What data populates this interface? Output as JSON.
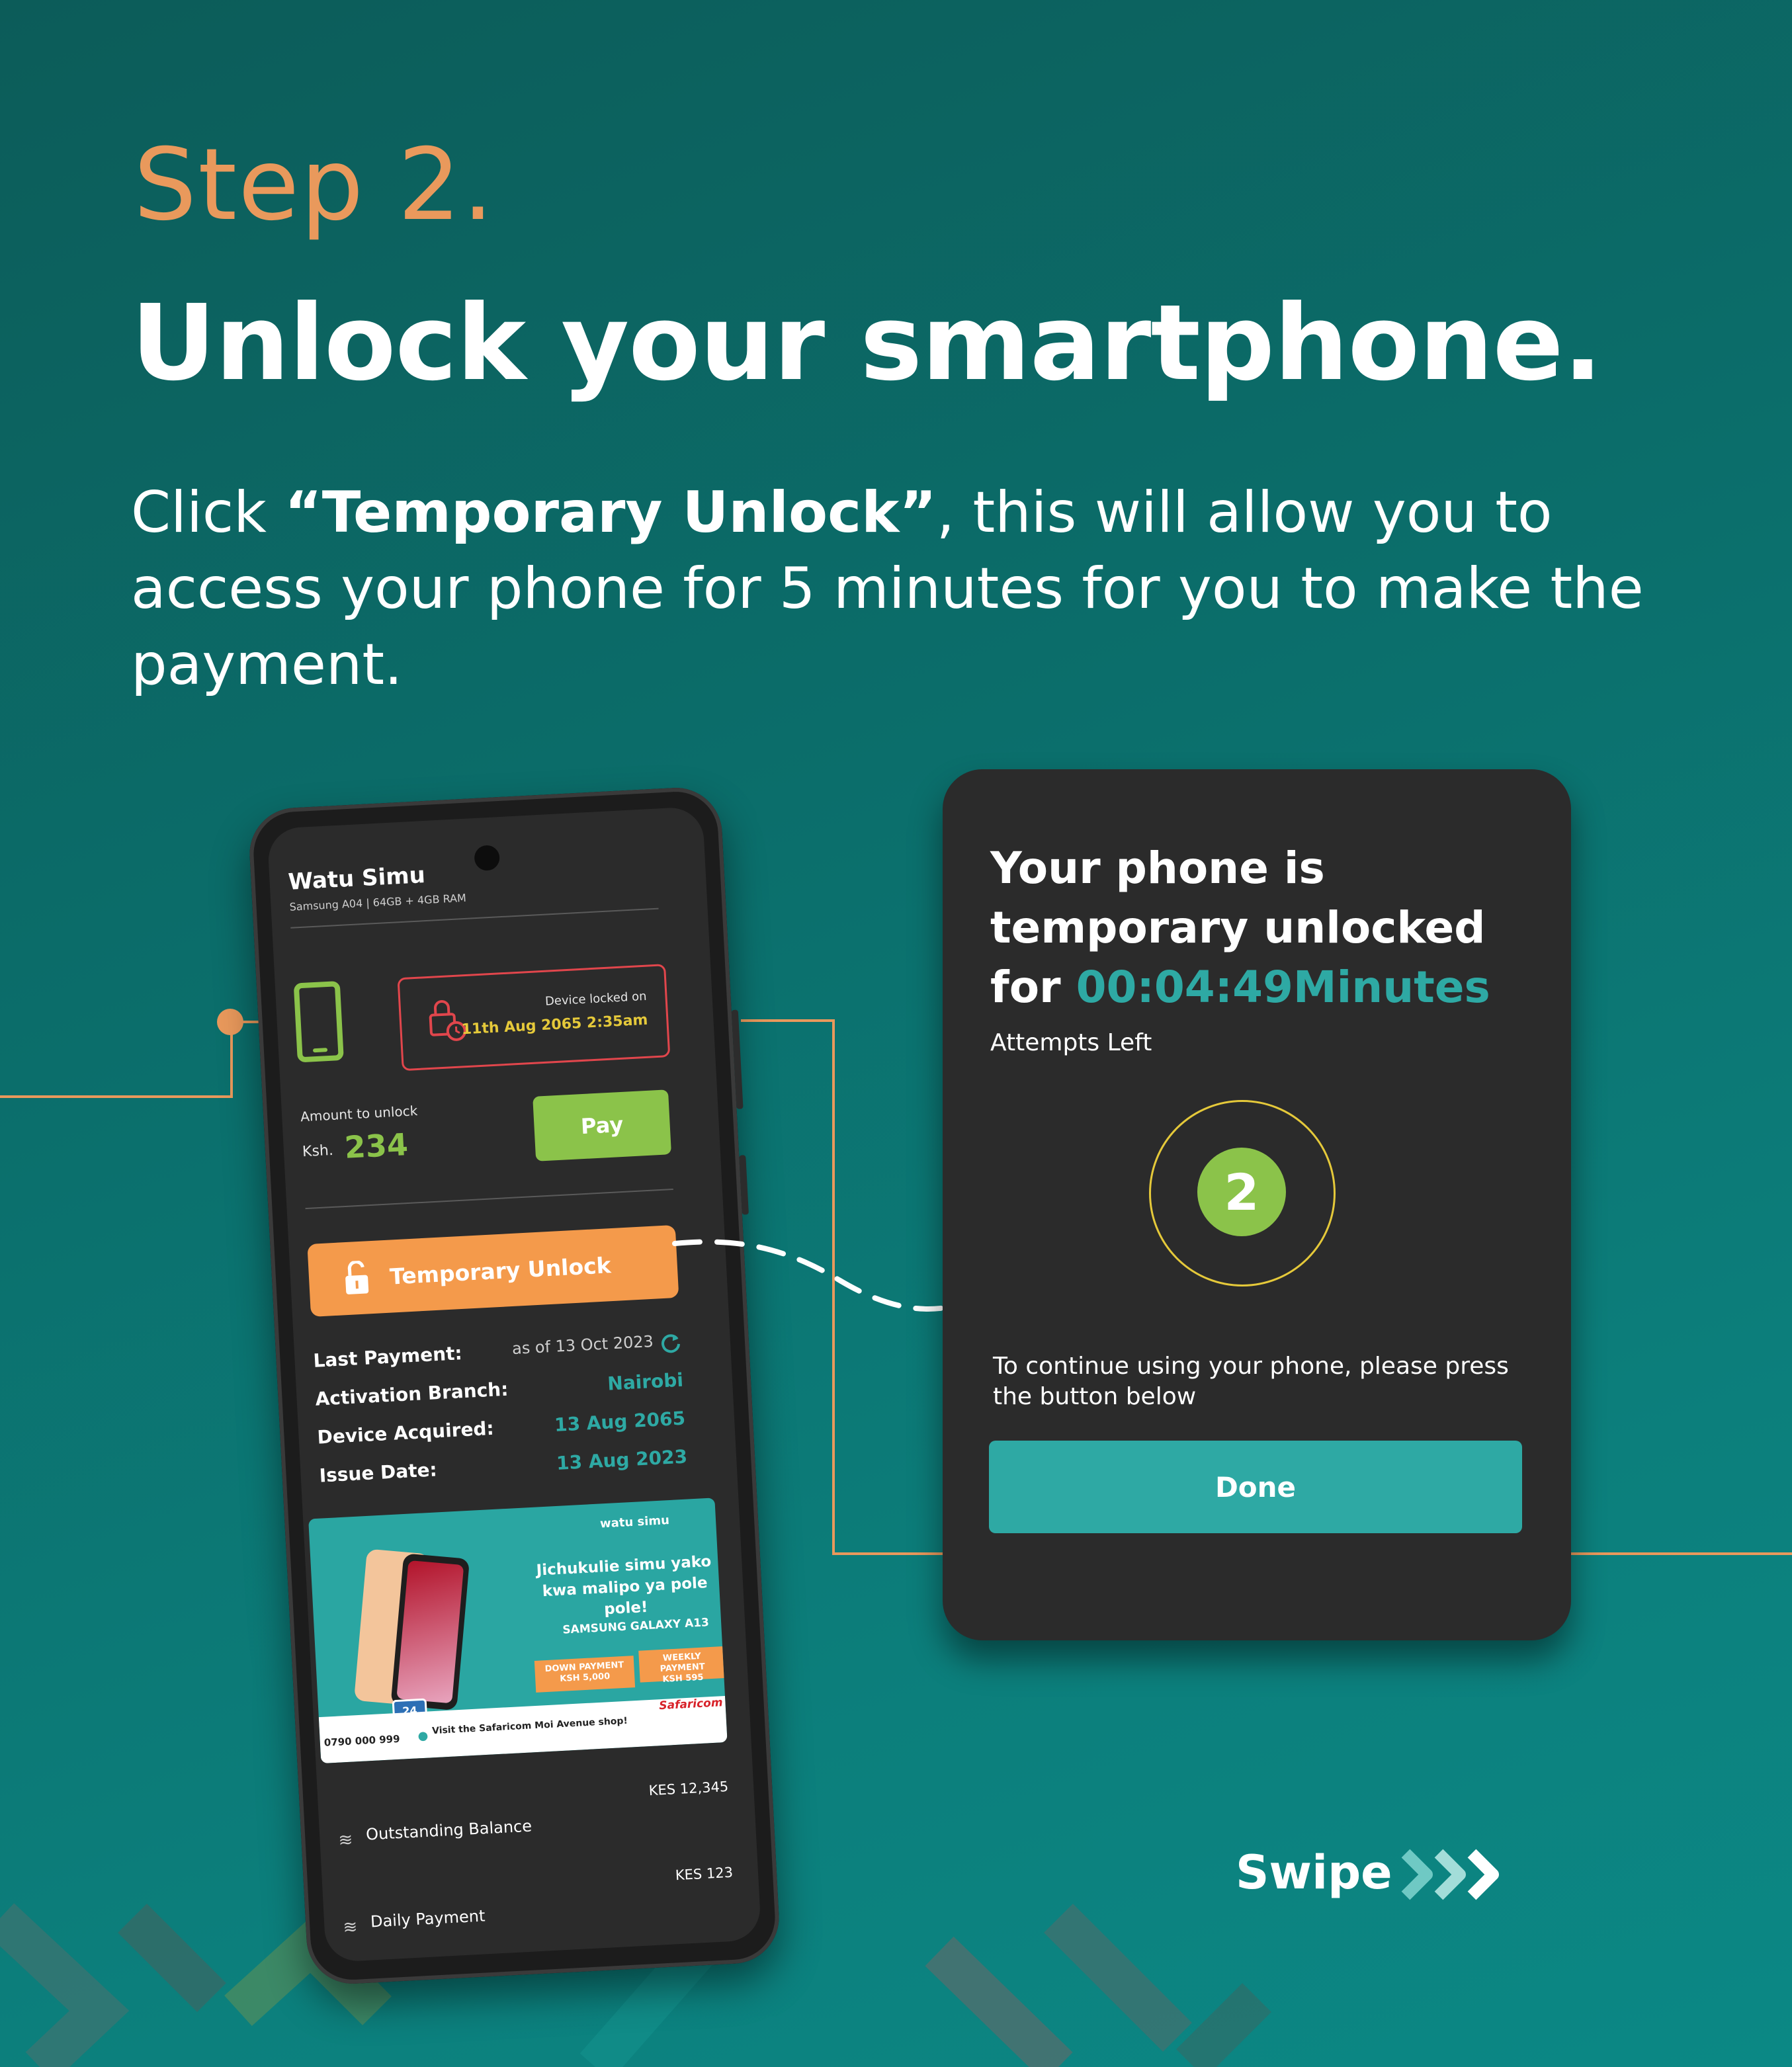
{
  "header": {
    "step": "Step 2.",
    "headline": "Unlock your smartphone.",
    "desc_before": "Click ",
    "desc_bold": "“Temporary Unlock”",
    "desc_after": ", this will allow you to access your phone for 5 minutes for you to make the payment."
  },
  "phone": {
    "app_title": "Watu Simu",
    "device_spec": "Samsung A04 | 64GB + 4GB RAM",
    "lock_label": "Device  locked on",
    "lock_date": "11th Aug 2065  2:35am",
    "amount_label": "Amount to unlock",
    "currency": "Ksh.",
    "amount": "234",
    "pay_label": "Pay",
    "temp_unlock_label": "Temporary Unlock",
    "details": [
      {
        "key": "Last Payment:",
        "value": "as of 13 Oct 2023"
      },
      {
        "key": "Activation Branch:",
        "value": "Nairobi"
      },
      {
        "key": "Device Acquired:",
        "value": "13 Aug 2065"
      },
      {
        "key": "Issue Date:",
        "value": "13 Aug 2023"
      }
    ],
    "ad": {
      "brand": "watu simu",
      "headline": "Jichukulie simu yako kwa malipo ya pole pole!",
      "model": "SAMSUNG GALAXY A13",
      "down_label": "DOWN PAYMENT",
      "down_value": "KSH 5,000",
      "weekly_label": "WEEKLY PAYMENT",
      "weekly_value": "KSH 595",
      "badge": "24",
      "phone": "0790 000 999",
      "visit": "Visit the Safaricom Moi Avenue shop!",
      "sponsor": "Safaricom"
    },
    "balances": [
      {
        "label": "Outstanding Balance",
        "value": "KES 12,345"
      },
      {
        "label": "Daily Payment",
        "value": "KES 123"
      }
    ]
  },
  "card": {
    "title_line1": "Your phone is",
    "title_line2": "temporary unlocked",
    "title_for": "for ",
    "timer": "00:04:49Minutes",
    "attempts_label": "Attempts Left",
    "attempts": "2",
    "continue_text": "To continue using your phone, please press the button below",
    "done_label": "Done"
  },
  "swipe": {
    "label": "Swipe"
  },
  "colors": {
    "accent_orange": "#e9995c",
    "teal": "#2ea9a4",
    "green": "#8bc34a",
    "alert_red": "#e1464c"
  }
}
